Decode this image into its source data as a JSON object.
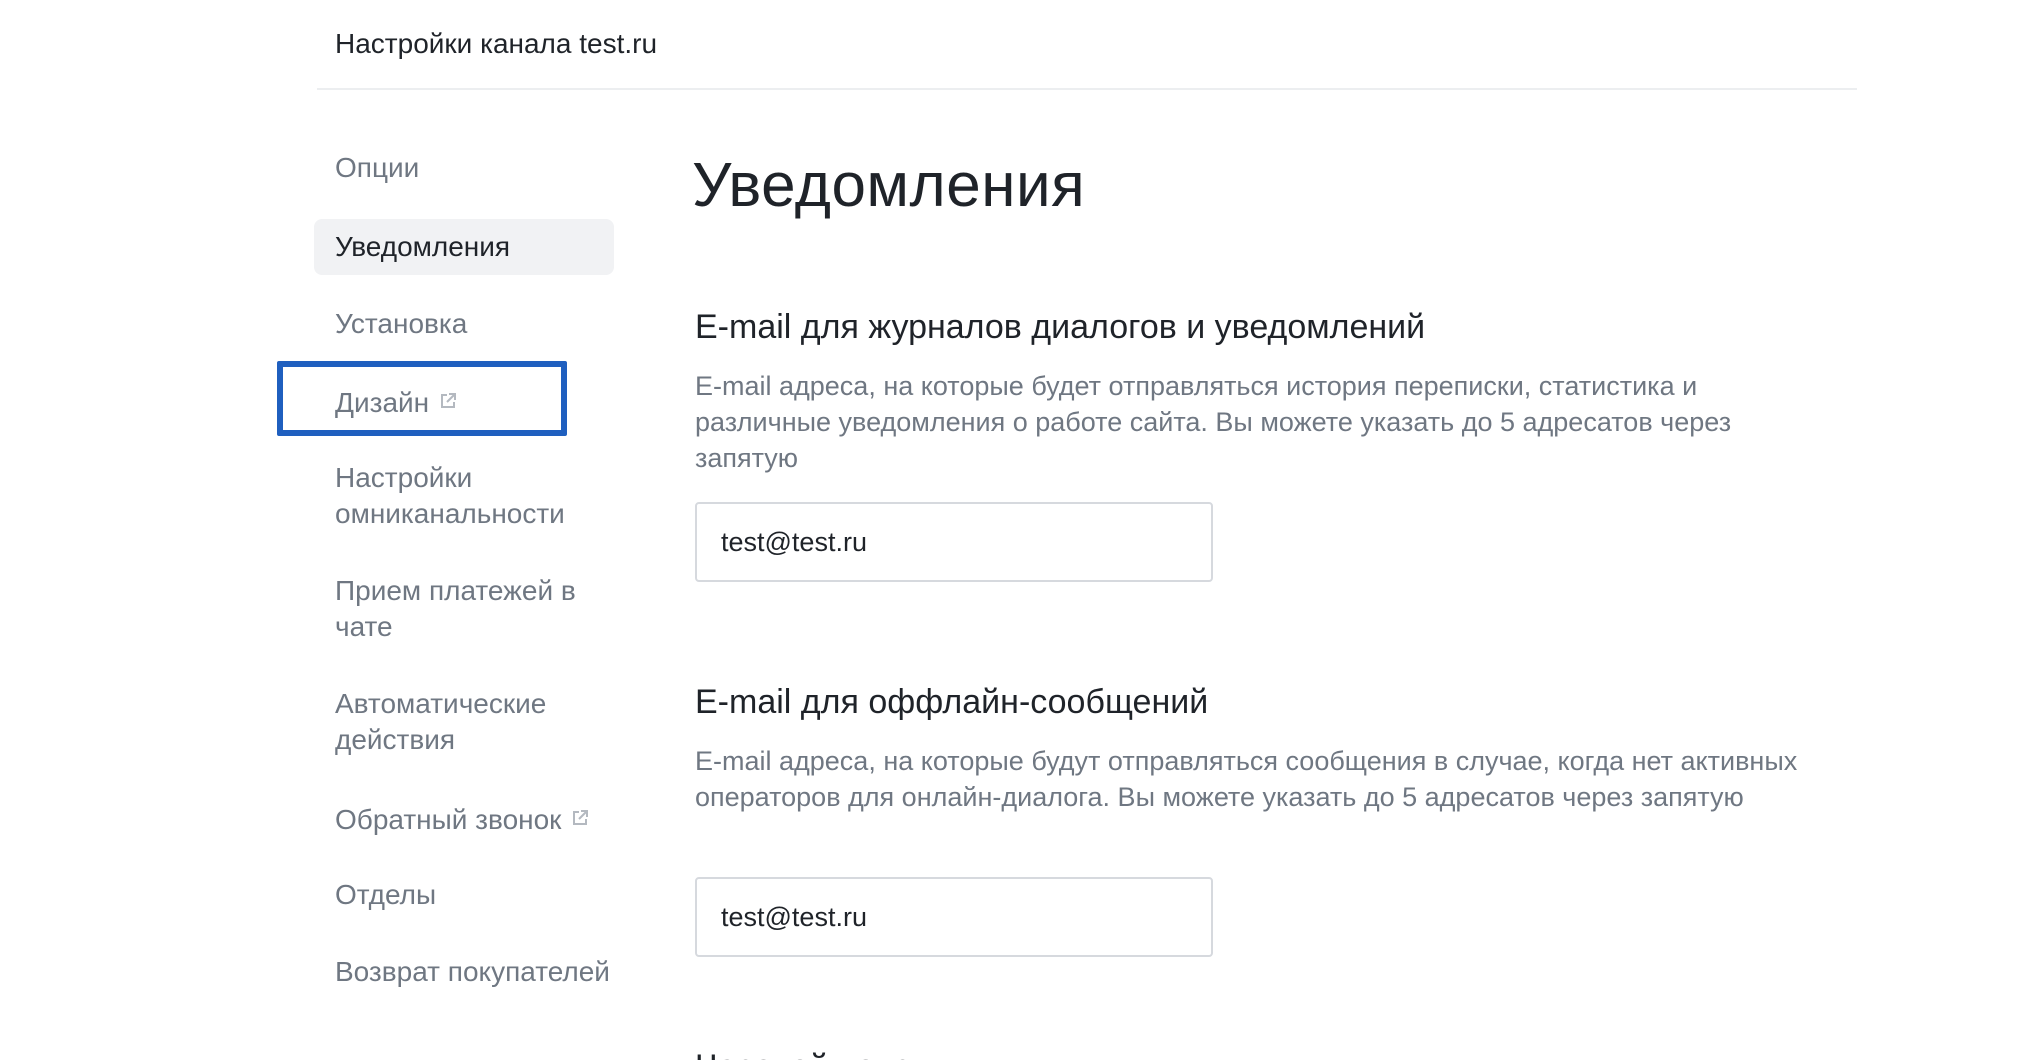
{
  "header": {
    "title": "Настройки канала test.ru"
  },
  "sidebar": {
    "items": [
      {
        "label": "Опции"
      },
      {
        "label": "Уведомления"
      },
      {
        "label": "Установка"
      },
      {
        "label": "Дизайн",
        "icon": "external-link-icon"
      },
      {
        "label": "Настройки омниканальности"
      },
      {
        "label": "Прием платежей в чате"
      },
      {
        "label": "Автоматические действия"
      },
      {
        "label": "Обратный звонок",
        "icon": "external-link-icon"
      },
      {
        "label": "Отделы"
      },
      {
        "label": "Возврат покупателей"
      }
    ],
    "active_index": 1,
    "highlight_color": "#1f5fbf"
  },
  "main": {
    "title": "Уведомления",
    "sections": [
      {
        "title": "E-mail для журналов диалогов и уведомлений",
        "description": "E-mail адреса, на которые будет отправляться история переписки, статистика и различные уведомления о работе сайта. Вы можете указать до 5 адресатов через запятую",
        "value": "test@test.ru"
      },
      {
        "title": "E-mail для оффлайн-сообщений",
        "description": "E-mail адреса, на которые будут отправляться сообщения в случае, когда нет активных операторов для онлайн-диалога. Вы можете указать до 5 адресатов через запятую",
        "value": "test@test.ru"
      },
      {
        "title": "Часовой пояс"
      }
    ]
  },
  "colors": {
    "text_primary": "#1f2329",
    "text_secondary": "#6f7782",
    "active_bg": "#f1f2f4",
    "border": "#d6d9de",
    "highlight": "#1f5fbf"
  }
}
